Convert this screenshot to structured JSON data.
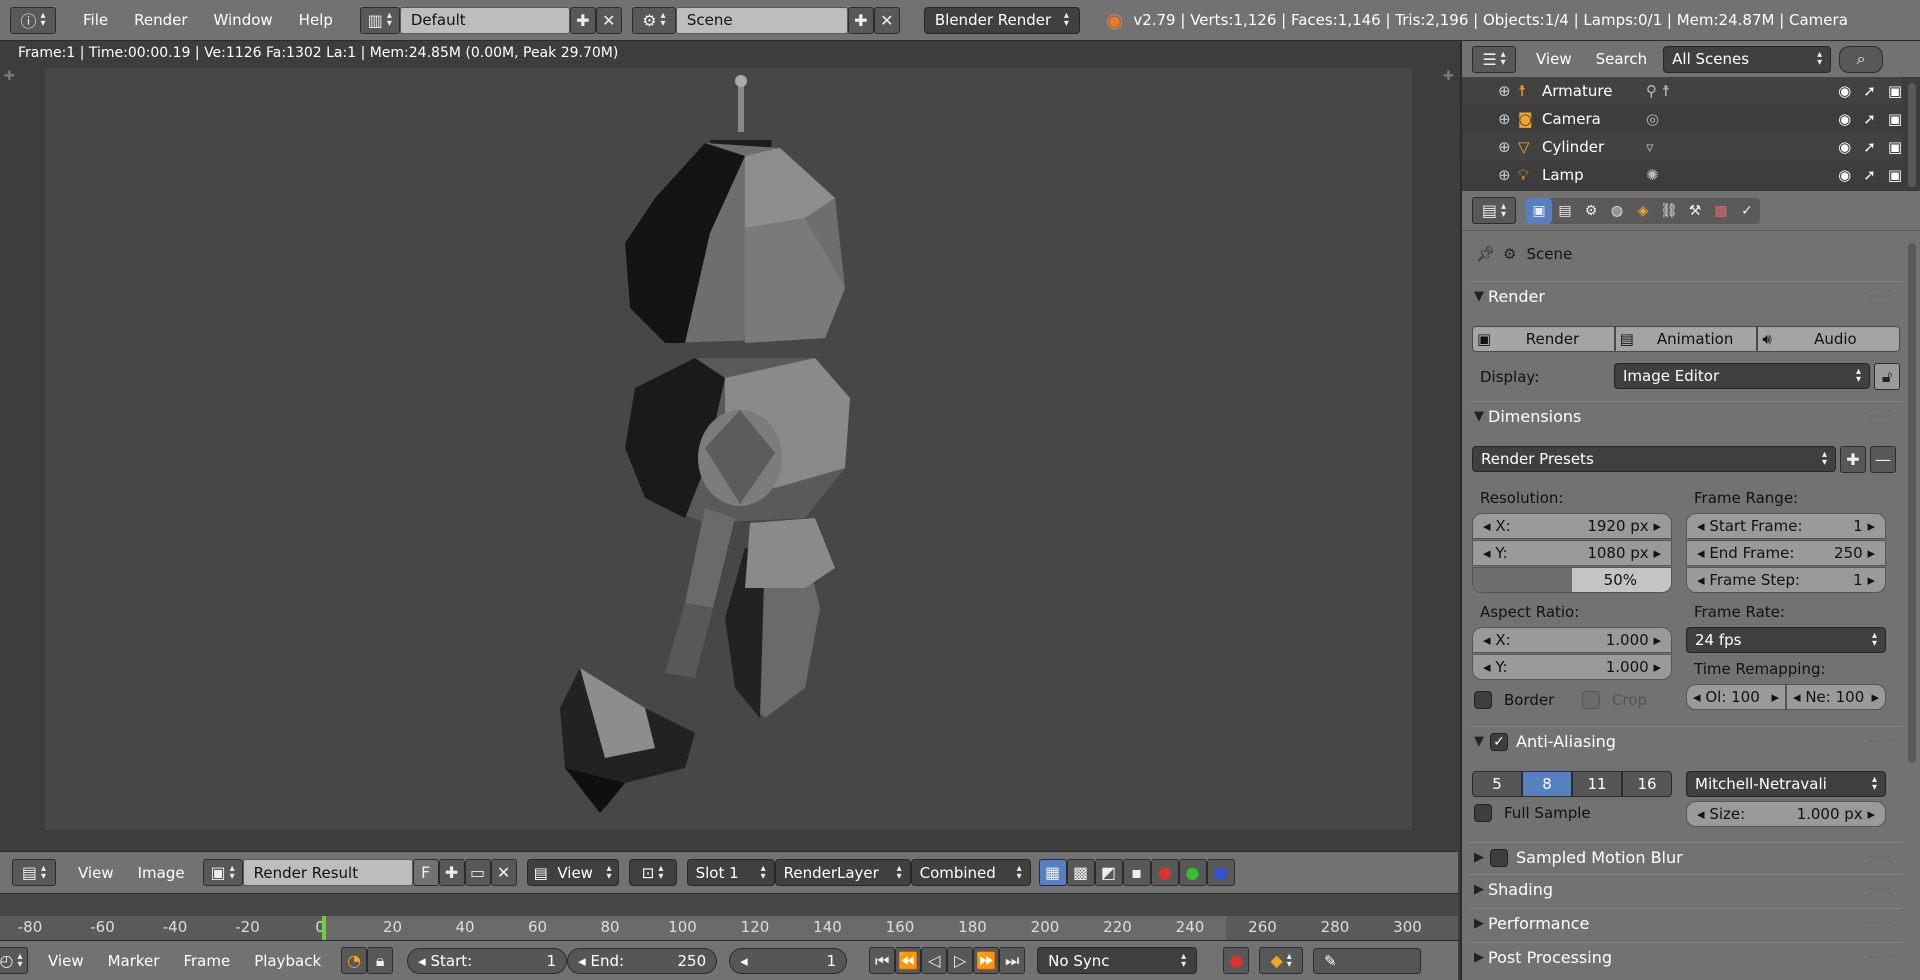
{
  "topbar": {
    "menus": [
      "File",
      "Render",
      "Window",
      "Help"
    ],
    "layout": "Default",
    "scene": "Scene",
    "engine": "Blender Render",
    "stats": "v2.79 | Verts:1,126 | Faces:1,146 | Tris:2,196 | Objects:1/4 | Lamps:0/1 | Mem:24.87M | Camera"
  },
  "viewport": {
    "render_stats": "Frame:1 | Time:00:00.19 | Ve:1126 Fa:1302 La:1 | Mem:24.85M (0.00M, Peak 29.70M)"
  },
  "image_header": {
    "view": "View",
    "image": "Image",
    "image_name": "Render Result",
    "fake_user": "F",
    "view_dropdown": "View",
    "slot": "Slot 1",
    "layer": "RenderLayer",
    "pass": "Combined"
  },
  "timeline": {
    "ticks": [
      "-80",
      "-60",
      "-40",
      "-20",
      "0",
      "20",
      "40",
      "60",
      "80",
      "100",
      "120",
      "140",
      "160",
      "180",
      "200",
      "220",
      "240",
      "260",
      "280",
      "300"
    ]
  },
  "bottombar": {
    "menus": [
      "View",
      "Marker",
      "Frame",
      "Playback"
    ],
    "start_label": "Start:",
    "start": "1",
    "end_label": "End:",
    "end": "250",
    "current": "1",
    "sync": "No Sync"
  },
  "outliner": {
    "view": "View",
    "search": "Search",
    "filter": "All Scenes",
    "items": [
      {
        "name": "Armature",
        "icon": "armature-icon"
      },
      {
        "name": "Camera",
        "icon": "camera-icon"
      },
      {
        "name": "Cylinder",
        "icon": "mesh-icon"
      },
      {
        "name": "Lamp",
        "icon": "lamp-icon"
      }
    ]
  },
  "props": {
    "context": "Scene",
    "render_panel": {
      "title": "Render",
      "render_btn": "Render",
      "animation_btn": "Animation",
      "audio_btn": "Audio",
      "display_label": "Display:",
      "display_value": "Image Editor"
    },
    "dimensions": {
      "title": "Dimensions",
      "presets": "Render Presets",
      "resolution_label": "Resolution:",
      "res_x_label": "X:",
      "res_x": "1920 px",
      "res_y_label": "Y:",
      "res_y": "1080 px",
      "res_pct": "50%",
      "res_pct_fraction": 0.5,
      "frame_range_label": "Frame Range:",
      "start_frame_label": "Start Frame:",
      "start_frame": "1",
      "end_frame_label": "End Frame:",
      "end_frame": "250",
      "frame_step_label": "Frame Step:",
      "frame_step": "1",
      "aspect_label": "Aspect Ratio:",
      "asp_x_label": "X:",
      "asp_x": "1.000",
      "asp_y_label": "Y:",
      "asp_y": "1.000",
      "frame_rate_label": "Frame Rate:",
      "frame_rate": "24 fps",
      "time_remap_label": "Time Remapping:",
      "old_label": "Ol:",
      "old": "100",
      "new_label": "Ne:",
      "new": "100",
      "border": "Border",
      "crop": "Crop"
    },
    "anti_aliasing": {
      "title": "Anti-Aliasing",
      "samples": [
        "5",
        "8",
        "11",
        "16"
      ],
      "active_sample": "8",
      "filter": "Mitchell-Netravali",
      "full_sample": "Full Sample",
      "size_label": "Size:",
      "size": "1.000 px"
    },
    "collapsed_panels": [
      "Sampled Motion Blur",
      "Shading",
      "Performance",
      "Post Processing"
    ]
  },
  "colors": {
    "header": "#727272",
    "viewport_bg": "#3d3d3d",
    "canvas_bg": "#474747",
    "accent_blue": "#5680c2",
    "playhead": "#69d23a",
    "blender_orange": "#f5792a"
  }
}
